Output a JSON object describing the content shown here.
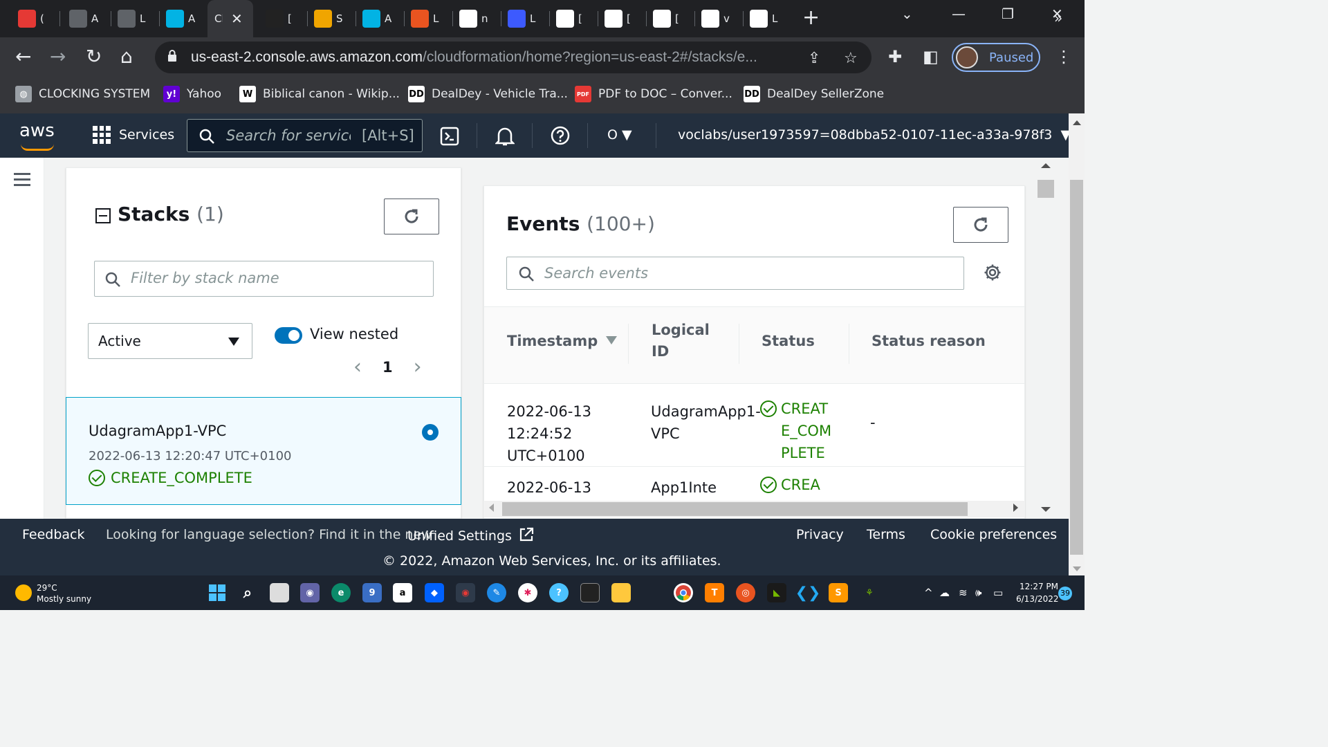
{
  "browser": {
    "tabs": [
      {
        "title": "(",
        "icon": "checker-favicon-icon",
        "color": "#e53935"
      },
      {
        "title": "A",
        "icon": "terminal-favicon-icon",
        "color": "#5f6368"
      },
      {
        "title": "L",
        "icon": "terminal-favicon-icon",
        "color": "#5f6368"
      },
      {
        "title": "A",
        "icon": "udacity-favicon-icon",
        "color": "#02b3e4"
      },
      {
        "title": "Cl",
        "icon": "",
        "color": "#35363a",
        "active": true
      },
      {
        "title": "[",
        "icon": "mortarboard-favicon-icon",
        "color": "#222"
      },
      {
        "title": "S",
        "icon": "box-favicon-icon",
        "color": "#f0a500"
      },
      {
        "title": "A",
        "icon": "udacity-favicon-icon",
        "color": "#02b3e4"
      },
      {
        "title": "L",
        "icon": "ubuntu-favicon-icon",
        "color": "#e95420"
      },
      {
        "title": "n",
        "icon": "github-favicon-icon",
        "color": "#ffffff"
      },
      {
        "title": "L",
        "icon": "udacity-favicon-icon",
        "color": "#3d5afe"
      },
      {
        "title": "[",
        "icon": "github-favicon-icon",
        "color": "#ffffff"
      },
      {
        "title": "[",
        "icon": "github-favicon-icon",
        "color": "#ffffff"
      },
      {
        "title": "[",
        "icon": "shoe-favicon-icon",
        "color": "#ffffff"
      },
      {
        "title": "v",
        "icon": "google-favicon-icon",
        "color": "#ffffff"
      },
      {
        "title": "L",
        "icon": "feather-favicon-icon",
        "color": "#ffffff"
      }
    ],
    "url_host": "us-east-2.console.aws.amazon.com",
    "url_path": "/cloudformation/home?region=us-east-2#/stacks/e...",
    "profile_label": "Paused",
    "bookmarks": [
      {
        "label": "CLOCKING SYSTEM",
        "icon": "globe-icon",
        "color": "#9aa0a6"
      },
      {
        "label": "Yahoo",
        "icon": "yahoo-icon",
        "color": "#6001d2"
      },
      {
        "label": "Biblical canon - Wikip...",
        "icon": "wikipedia-icon",
        "color": "#ffffff"
      },
      {
        "label": "DealDey - Vehicle Tra...",
        "icon": "dealdey-icon",
        "color": "#ffffff"
      },
      {
        "label": "PDF to DOC – Conver...",
        "icon": "pdf-doc-icon",
        "color": "#e53935"
      },
      {
        "label": "DealDey SellerZone",
        "icon": "dealdey-icon",
        "color": "#ffffff"
      }
    ]
  },
  "aws": {
    "logo": "aws",
    "services_label": "Services",
    "search_placeholder": "Search for services",
    "search_shortcut": "[Alt+S]",
    "region_label": "O",
    "account": "voclabs/user1973597=08dbba52-0107-11ec-a33a-978f3"
  },
  "stacks": {
    "title": "Stacks",
    "count": "(1)",
    "filter_placeholder": "Filter by stack name",
    "status_filter": "Active",
    "view_nested_label": "View nested",
    "view_nested_on": true,
    "page": "1",
    "items": [
      {
        "name": "UdagramApp1-VPC",
        "created": "2022-06-13 12:20:47 UTC+0100",
        "status": "CREATE_COMPLETE",
        "selected": true
      }
    ]
  },
  "events": {
    "title": "Events",
    "count": "(100+)",
    "search_placeholder": "Search events",
    "columns": [
      "Timestamp",
      "Logical ID",
      "Status",
      "Status reason"
    ],
    "rows": [
      {
        "timestamp": "2022-06-13 12:24:52 UTC+0100",
        "logical_id": "UdagramApp1-VPC",
        "status": "CREATE_COMPLETE",
        "reason": "-"
      },
      {
        "timestamp": "2022-06-13",
        "logical_id": "App1Inte",
        "status": "CREA",
        "reason": ""
      }
    ]
  },
  "footer": {
    "feedback": "Feedback",
    "language_msg": "Looking for language selection? Find it in the new",
    "unified_settings": "Unified Settings",
    "privacy": "Privacy",
    "terms": "Terms",
    "cookies": "Cookie preferences",
    "copyright": "© 2022, Amazon Web Services, Inc. or its affiliates."
  },
  "taskbar": {
    "temperature": "29°C",
    "weather": "Mostly sunny",
    "time": "12:27 PM",
    "date": "6/13/2022",
    "notifications": "39",
    "teams_badge": "9"
  }
}
